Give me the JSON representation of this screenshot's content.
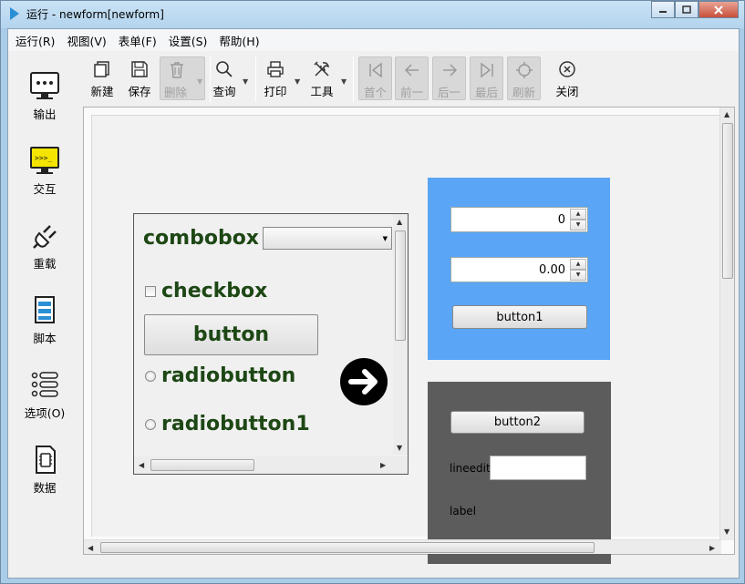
{
  "window": {
    "title": "运行 - newform[newform]",
    "controls": [
      "minimize",
      "maximize",
      "close"
    ]
  },
  "menubar": [
    "运行(R)",
    "视图(V)",
    "表单(F)",
    "设置(S)",
    "帮助(H)"
  ],
  "left_toolbar": [
    {
      "label": "输出",
      "icon": "monitor-icon"
    },
    {
      "label": "交互",
      "icon": "terminal-icon"
    },
    {
      "label": "重载",
      "icon": "plug-icon"
    },
    {
      "label": "脚本",
      "icon": "script-icon"
    },
    {
      "label": "选项(O)",
      "icon": "list-icon"
    },
    {
      "label": "数据",
      "icon": "data-icon"
    }
  ],
  "toolbar": {
    "new": "新建",
    "save": "保存",
    "delete": "删除",
    "query": "查询",
    "print": "打印",
    "tools": "工具",
    "first": "首个",
    "prev": "前一",
    "next": "后一",
    "last": "最后",
    "refresh": "刷新",
    "close": "关闭"
  },
  "form": {
    "combobox_label": "combobox",
    "combobox_value": "",
    "checkbox_label": "checkbox",
    "checkbox_checked": false,
    "button_label": "button",
    "radio1_label": "radiobutton",
    "radio2_label": "radiobutton1",
    "spin_int_value": "0",
    "spin_double_value": "0.00",
    "button1_label": "button1",
    "button2_label": "button2",
    "lineedit_label": "lineedit",
    "lineedit_value": "",
    "label_text": "label"
  },
  "colors": {
    "title_bar": "#b3d4ee",
    "blue_group": "#5aa5f5",
    "dark_group": "#5c5c5c",
    "form_text_green": "#1d4714"
  }
}
